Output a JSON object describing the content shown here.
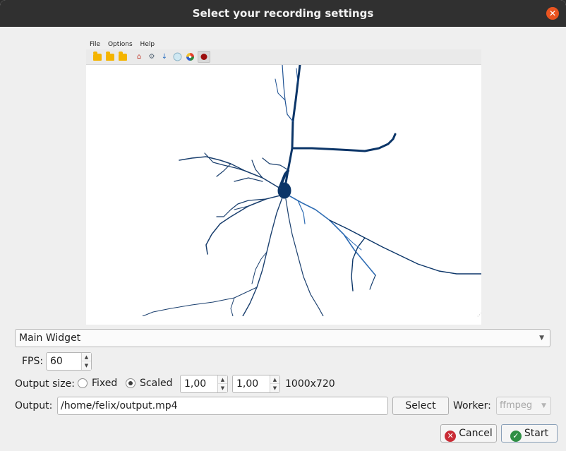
{
  "window": {
    "title": "Select your recording settings",
    "close_icon": "close-icon"
  },
  "preview": {
    "menu": [
      "File",
      "Options",
      "Help"
    ],
    "toolbar_icons": [
      "folder-open-icon",
      "folder-icon",
      "folder-icon",
      "home-icon",
      "gear-icon",
      "download-icon",
      "circle-icon",
      "color-wheel-icon",
      "record-icon"
    ]
  },
  "source": {
    "selected": "Main Widget"
  },
  "fps": {
    "label": "FPS:",
    "value": "60"
  },
  "output_size": {
    "label": "Output size:",
    "fixed_label": "Fixed",
    "scaled_label": "Scaled",
    "selected": "Scaled",
    "scale_x": "1,00",
    "scale_y": "1,00",
    "resolution": "1000x720"
  },
  "output": {
    "label": "Output:",
    "path": "/home/felix/output.mp4",
    "select_label": "Select"
  },
  "worker": {
    "label": "Worker:",
    "value": "ffmpeg"
  },
  "buttons": {
    "cancel_label": "Cancel",
    "start_label": "Start"
  },
  "colors": {
    "titlebar": "#303030",
    "close": "#e95420",
    "neuron_dark": "#0b3568",
    "neuron_light": "#2f6db4"
  }
}
